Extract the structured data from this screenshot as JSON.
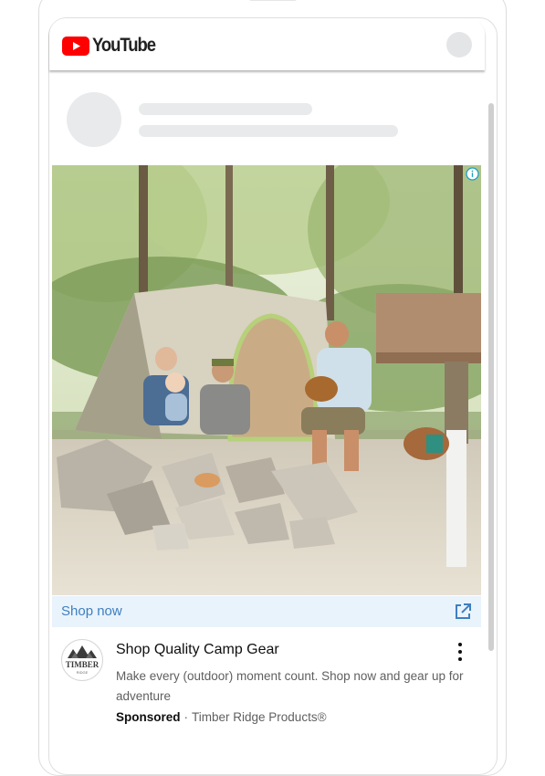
{
  "header": {
    "logo_text": "YouTube",
    "brand_red": "#ff0000"
  },
  "ad": {
    "info_icon": "info-icon",
    "image_alt": "Family camping around a fire pit next to a tent in a pine forest",
    "cta_label": "Shop now",
    "cta_icon": "external-link-icon",
    "cta_color": "#3f7fbf",
    "title": "Shop Quality Camp Gear",
    "description": "Make every (outdoor) moment count. Shop now and gear up for adventure",
    "sponsored_label": "Sponsored",
    "separator": "·",
    "advertiser": "Timber Ridge Products®",
    "logo_text": "TIMBER",
    "logo_subtext": "RIDGE",
    "menu_icon": "more-vert-icon"
  }
}
